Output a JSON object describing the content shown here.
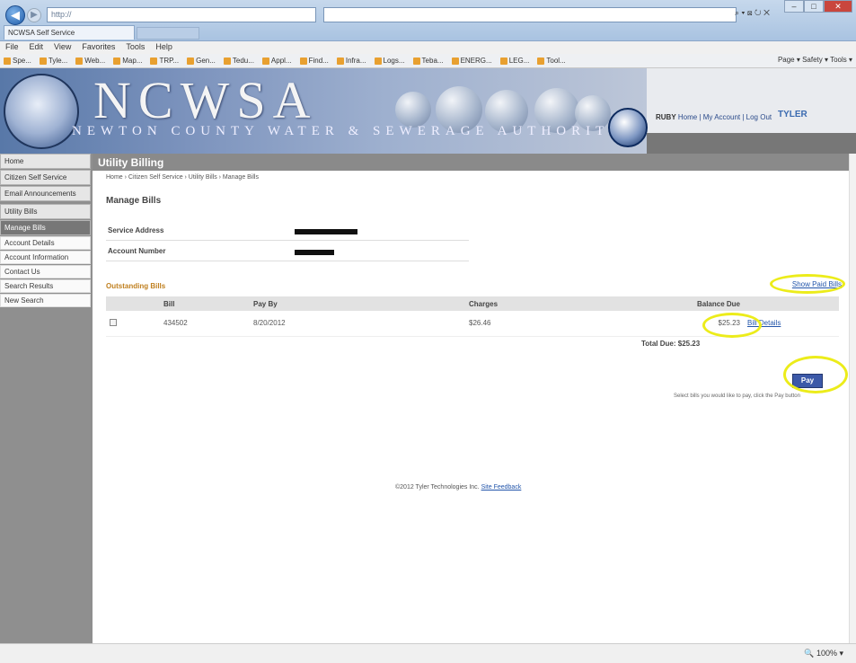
{
  "browser": {
    "address": "http://",
    "tab_title": "NCWSA Self Service",
    "menu": [
      "File",
      "Edit",
      "View",
      "Favorites",
      "Tools",
      "Help"
    ],
    "favorites": [
      "Spe...",
      "Tyle...",
      "Web...",
      "Map...",
      "TRP...",
      "Gen...",
      "Tedu...",
      "Appl...",
      "Find...",
      "Infra...",
      "Logs...",
      "Teba...",
      "ENERG...",
      "LEG...",
      "Tool..."
    ],
    "toolbar_right": "Page ▾  Safety ▾  Tools ▾",
    "zoom": "100%"
  },
  "site": {
    "logo_text": "NCWSA",
    "logo_sub": "NEWTON COUNTY WATER & SEWERAGE AUTHORITY",
    "top_links": "Home | My Account | Log Out",
    "top_links_prefix": "RUBY",
    "tyler": "TYLER"
  },
  "sidebar": {
    "items": [
      {
        "label": "Home",
        "kind": "normal"
      },
      {
        "label": "Citizen Self Service",
        "kind": "normal"
      },
      {
        "label": "Email Announcements",
        "kind": "normal"
      },
      {
        "label": "Utility Bills",
        "kind": "normal"
      },
      {
        "label": "Manage Bills",
        "kind": "active"
      },
      {
        "label": "Account Details",
        "kind": "sub"
      },
      {
        "label": "Account Information",
        "kind": "sub"
      },
      {
        "label": "Contact Us",
        "kind": "sub"
      },
      {
        "label": "Search Results",
        "kind": "sub"
      },
      {
        "label": "New Search",
        "kind": "sub"
      }
    ]
  },
  "main": {
    "heading": "Utility Billing",
    "breadcrumb": "Home › Citizen Self Service › Utility Bills › Manage Bills",
    "title": "Manage Bills",
    "service_address_label": "Service Address",
    "account_number_label": "Account Number",
    "outstanding_title": "Outstanding Bills",
    "show_paid": "Show Paid Bills",
    "columns": [
      "",
      "Bill",
      "Pay By",
      "Charges",
      "Balance Due",
      ""
    ],
    "rows": [
      {
        "bill": "434502",
        "pay_by": "8/20/2012",
        "charges": "$26.46",
        "balance": "$25.23",
        "link": "Bill Details"
      }
    ],
    "total_due": "Total Due: $25.23",
    "pay_label": "Pay",
    "pay_note": "Select bills you would like to pay, click the Pay button",
    "footer_text": "©2012 Tyler Technologies Inc.",
    "footer_link": "Site Feedback"
  },
  "colors": {
    "highlight": "#ecec1a",
    "accent": "#3c59a8",
    "section_title": "#c08020"
  }
}
